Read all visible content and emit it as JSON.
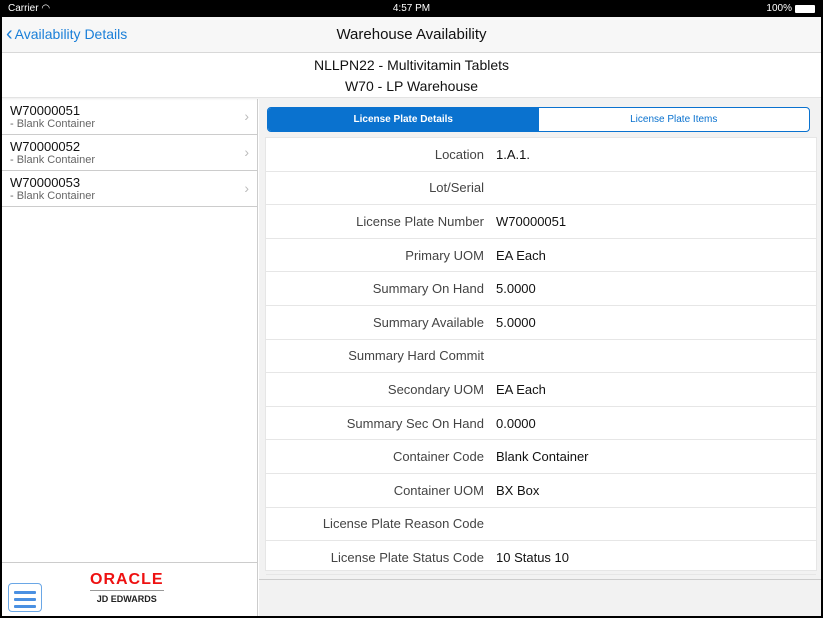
{
  "status": {
    "carrier": "Carrier",
    "time": "4:57 PM",
    "battery": "100%"
  },
  "nav": {
    "back": "Availability Details",
    "title": "Warehouse Availability"
  },
  "header": {
    "item": "NLLPN22 - Multivitamin Tablets",
    "warehouse": "W70 - LP Warehouse"
  },
  "list": [
    {
      "id": "W70000051",
      "desc": "- Blank Container"
    },
    {
      "id": "W70000052",
      "desc": "- Blank Container"
    },
    {
      "id": "W70000053",
      "desc": "- Blank Container"
    }
  ],
  "tabs": [
    "License Plate Details",
    "License Plate Items"
  ],
  "details": [
    {
      "label": "Location",
      "value": "1.A.1."
    },
    {
      "label": "Lot/Serial",
      "value": ""
    },
    {
      "label": "License Plate Number",
      "value": "W70000051"
    },
    {
      "label": "Primary UOM",
      "value": "EA Each"
    },
    {
      "label": "Summary On Hand",
      "value": "5.0000"
    },
    {
      "label": "Summary Available",
      "value": "5.0000"
    },
    {
      "label": "Summary Hard Commit",
      "value": ""
    },
    {
      "label": "Secondary UOM",
      "value": "EA Each"
    },
    {
      "label": "Summary Sec On Hand",
      "value": "0.0000"
    },
    {
      "label": "Container Code",
      "value": "Blank Container"
    },
    {
      "label": "Container UOM",
      "value": "BX Box"
    },
    {
      "label": "License Plate Reason Code",
      "value": ""
    },
    {
      "label": "License Plate Status Code",
      "value": "10 Status 10"
    }
  ],
  "logo": {
    "brand": "ORACLE",
    "product": "JD EDWARDS"
  }
}
